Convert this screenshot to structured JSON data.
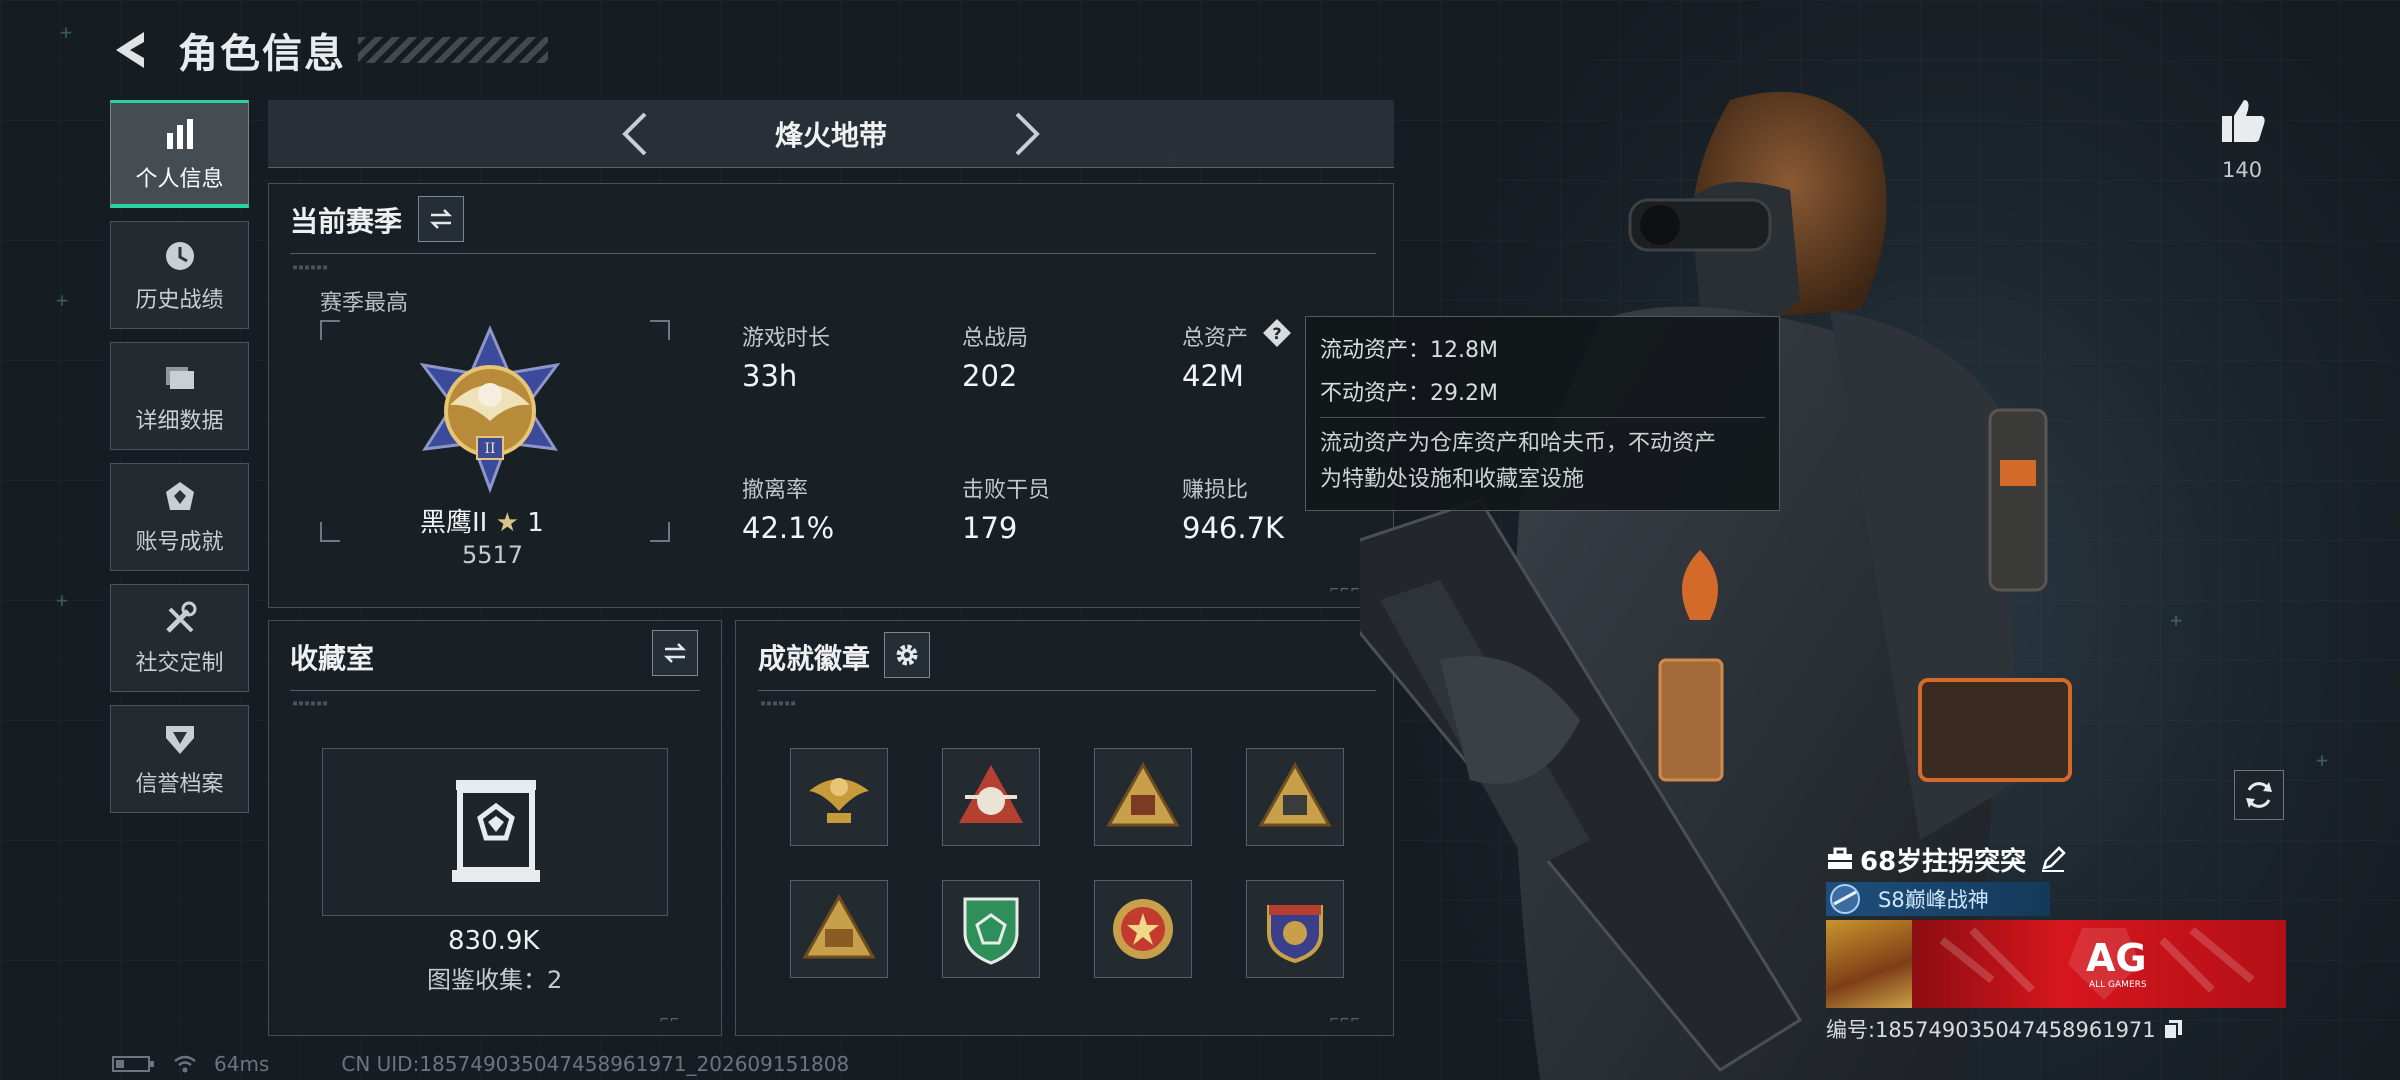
{
  "header": {
    "title": "角色信息"
  },
  "sidebar": {
    "items": [
      {
        "label": "个人信息",
        "icon": "bar-chart-icon",
        "active": true
      },
      {
        "label": "历史战绩",
        "icon": "clock-history-icon",
        "active": false
      },
      {
        "label": "详细数据",
        "icon": "folder-icon",
        "active": false
      },
      {
        "label": "账号成就",
        "icon": "achievement-icon",
        "active": false
      },
      {
        "label": "社交定制",
        "icon": "tools-icon",
        "active": false
      },
      {
        "label": "信誉档案",
        "icon": "shield-badge-icon",
        "active": false
      }
    ]
  },
  "mode": {
    "title": "烽火地带"
  },
  "season": {
    "title": "当前赛季",
    "best_label": "赛季最高",
    "rank_name": "黑鹰II",
    "rank_star": "★",
    "rank_stars": "1",
    "rank_score": "5517",
    "stats": [
      {
        "label": "游戏时长",
        "value": "33h"
      },
      {
        "label": "总战局",
        "value": "202"
      },
      {
        "label": "总资产",
        "value": "42M"
      },
      {
        "label": "撤离率",
        "value": "42.1%"
      },
      {
        "label": "击败干员",
        "value": "179"
      },
      {
        "label": "赚损比",
        "value": "946.7K"
      }
    ]
  },
  "tooltip": {
    "liquid": "流动资产：12.8M",
    "fixed": "不动资产：29.2M",
    "note_line1": "流动资产为仓库资产和哈夫币，不动资产",
    "note_line2": "为特勤处设施和收藏室设施"
  },
  "collection": {
    "title": "收藏室",
    "value": "830.9K",
    "collected": "图鉴收集：2"
  },
  "achievements": {
    "title": "成就徽章",
    "badges": [
      {
        "icon": "eagle-badge-icon",
        "color": "#c79a3c"
      },
      {
        "icon": "s9-emblem-badge-icon",
        "color": "#b6402f"
      },
      {
        "icon": "s8-triangle-badge-icon",
        "color": "#c9a04a"
      },
      {
        "icon": "s7-triangle-badge-icon",
        "color": "#c9a04a"
      },
      {
        "icon": "s11-triangle-badge-icon",
        "color": "#c9a04a"
      },
      {
        "icon": "green-shield-badge-icon",
        "color": "#2f8f5a"
      },
      {
        "icon": "star-medal-badge-icon",
        "color": "#c33b2e"
      },
      {
        "icon": "purple-crest-badge-icon",
        "color": "#c9a04a"
      }
    ]
  },
  "player": {
    "likes": "140",
    "name": "68岁拄拐突突",
    "title_badge": "S8巅峰战神",
    "team_logo": "AG",
    "team_sub": "ALL GAMERS",
    "id_label": "编号:185749035047458961971"
  },
  "status": {
    "ping": "64ms",
    "uid": "CN UID:185749035047458961971_202609151808"
  },
  "colors": {
    "accent": "#29d4a0",
    "team_red": "#d6161d"
  }
}
